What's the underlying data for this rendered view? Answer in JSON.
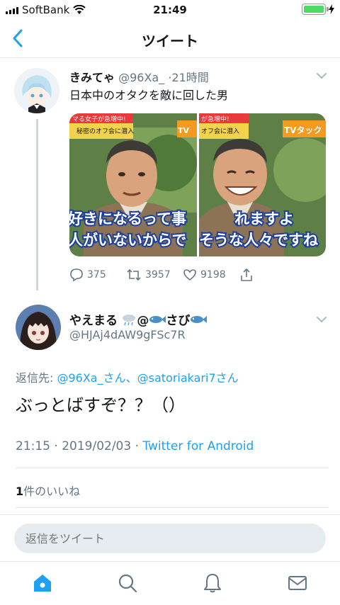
{
  "status_bar": {
    "carrier": "SoftBank",
    "time": "21:49"
  },
  "nav": {
    "title": "ツイート",
    "back_icon": "chevron-left-icon"
  },
  "tweet1": {
    "name": "きみてゃ",
    "handle": "@96Xa_",
    "time": "21時間",
    "text": "日本中のオタクを敵に回した男",
    "media": {
      "left_caption_top": "好きになるって事",
      "left_caption_bottom": "人がいないからで",
      "right_caption_top": "れますよ",
      "right_caption_bottom": "そうな人々ですね",
      "left_banner_1": "マる女子が急増中!",
      "left_banner_2": "秘密のオフ会に潜入",
      "right_banner_1": "が急増中!",
      "right_banner_2": "オフ会に潜入",
      "tv_label": "TVタック"
    },
    "actions": {
      "replies": "375",
      "retweets": "3957",
      "likes": "9198"
    }
  },
  "tweet2": {
    "name_prefix": "やえまる",
    "name_at": "@",
    "name_suffix": "さび",
    "handle": "@HJAj4dAW9gFSc7R",
    "reply_label": "返信先: ",
    "reply_targets": "@96Xa_さん、@satoriakari7さん",
    "text": "ぶっとばすぞ？？（）",
    "timestamp": "21:15 · 2019/02/03 · ",
    "client": "Twitter for Android",
    "likes_count": "1",
    "likes_label": "件のいいね"
  },
  "reply_bar": {
    "placeholder": "返信をツイート"
  },
  "tabs": [
    "home-icon",
    "search-icon",
    "notifications-icon",
    "messages-icon"
  ],
  "colors": {
    "accent": "#1da1f2",
    "muted": "#657786",
    "battery": "#4cd964"
  }
}
